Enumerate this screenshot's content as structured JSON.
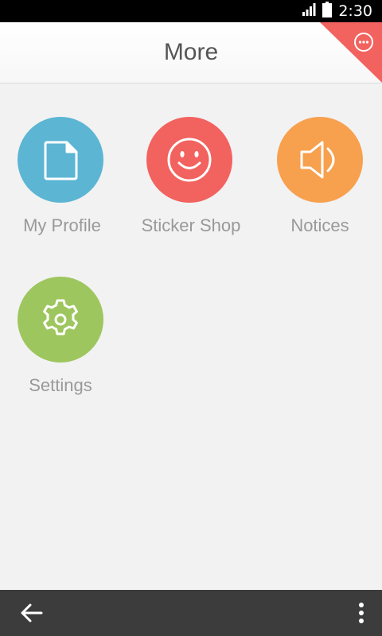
{
  "status_bar": {
    "time": "2:30",
    "icons": [
      "signal-icon",
      "battery-icon"
    ]
  },
  "header": {
    "title": "More",
    "corner_icon": "more-options-icon",
    "accent_color": "#f2625e"
  },
  "grid": {
    "items": [
      {
        "label": "My Profile",
        "icon": "document-icon",
        "color": "#5bb5d3"
      },
      {
        "label": "Sticker Shop",
        "icon": "smiley-icon",
        "color": "#f2625e"
      },
      {
        "label": "Notices",
        "icon": "speaker-icon",
        "color": "#f7a04e"
      },
      {
        "label": "Settings",
        "icon": "gear-icon",
        "color": "#9ec65e"
      }
    ]
  },
  "nav_bar": {
    "back_icon": "back-arrow-icon",
    "menu_icon": "overflow-menu-icon"
  }
}
